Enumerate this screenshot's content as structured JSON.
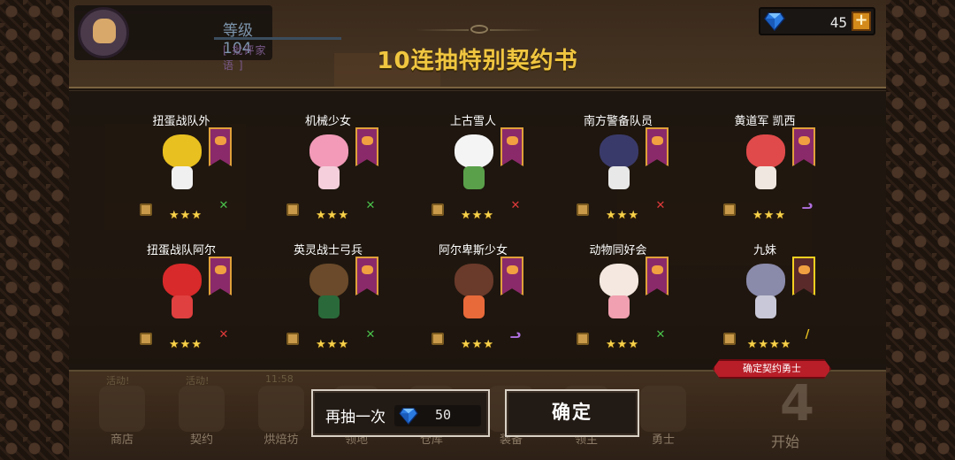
{
  "header": {
    "level_text": "等级104",
    "sub_text": "[ 批评家语 ]",
    "gems": "45",
    "plus": "+"
  },
  "title": "10连抽特别契约书",
  "heroes": [
    {
      "name": "扭蛋战队外",
      "stars": "★★★",
      "weapon_color": "#4ac04a",
      "weapon_icon": "✕",
      "banner": "purple",
      "head_color": "#e8c020",
      "body_color": "#f0f0f0"
    },
    {
      "name": "机械少女",
      "stars": "★★★",
      "weapon_color": "#4ac04a",
      "weapon_icon": "✕",
      "banner": "purple",
      "head_color": "#f29ab8",
      "body_color": "#f5d0dc"
    },
    {
      "name": "上古雪人",
      "stars": "★★★",
      "weapon_color": "#e03a3a",
      "weapon_icon": "✕",
      "banner": "purple",
      "head_color": "#f4f4f4",
      "body_color": "#5aa04a"
    },
    {
      "name": "南方警备队员",
      "stars": "★★★",
      "weapon_color": "#e03a3a",
      "weapon_icon": "✕",
      "banner": "purple",
      "head_color": "#3a3a6a",
      "body_color": "#e8e8e8"
    },
    {
      "name": "黄道军 凯西",
      "stars": "★★★",
      "weapon_color": "#b070e0",
      "weapon_icon": "ᓗ",
      "banner": "purple",
      "head_color": "#e04a4a",
      "body_color": "#f0e8e0"
    },
    {
      "name": "扭蛋战队阿尔",
      "stars": "★★★",
      "weapon_color": "#e03a3a",
      "weapon_icon": "✕",
      "banner": "purple",
      "head_color": "#d82a2a",
      "body_color": "#e04040"
    },
    {
      "name": "英灵战士弓兵",
      "stars": "★★★",
      "weapon_color": "#4ac04a",
      "weapon_icon": "✕",
      "banner": "purple",
      "head_color": "#6a4a2a",
      "body_color": "#2a6a3a"
    },
    {
      "name": "阿尔卑斯少女",
      "stars": "★★★",
      "weapon_color": "#b070e0",
      "weapon_icon": "ᓗ",
      "banner": "purple",
      "head_color": "#6a3a2a",
      "body_color": "#e86a3a"
    },
    {
      "name": "动物同好会",
      "stars": "★★★",
      "weapon_color": "#4ac04a",
      "weapon_icon": "✕",
      "banner": "purple",
      "head_color": "#f4e8e0",
      "body_color": "#f0a0b0"
    },
    {
      "name": "九妹",
      "stars": "★★★★",
      "weapon_color": "#e8c020",
      "weapon_icon": "/",
      "banner": "gold",
      "head_color": "#8a8aaa",
      "body_color": "#c8c8d8"
    }
  ],
  "confirm_ribbon": "确定契约勇士",
  "buttons": {
    "redraw_label": "再抽一次",
    "redraw_cost": "50",
    "ok_label": "确定"
  },
  "nav": {
    "items": [
      {
        "label": "商店",
        "badge": "活动!"
      },
      {
        "label": "契约",
        "badge": "活动!"
      },
      {
        "label": "烘焙坊",
        "badge": "11:58"
      },
      {
        "label": "领地",
        "badge": ""
      },
      {
        "label": "仓库",
        "badge": ""
      },
      {
        "label": "装备",
        "badge": ""
      },
      {
        "label": "领主",
        "badge": ""
      },
      {
        "label": "勇士",
        "badge": ""
      }
    ],
    "start_label": "开始",
    "start_number": "4"
  }
}
